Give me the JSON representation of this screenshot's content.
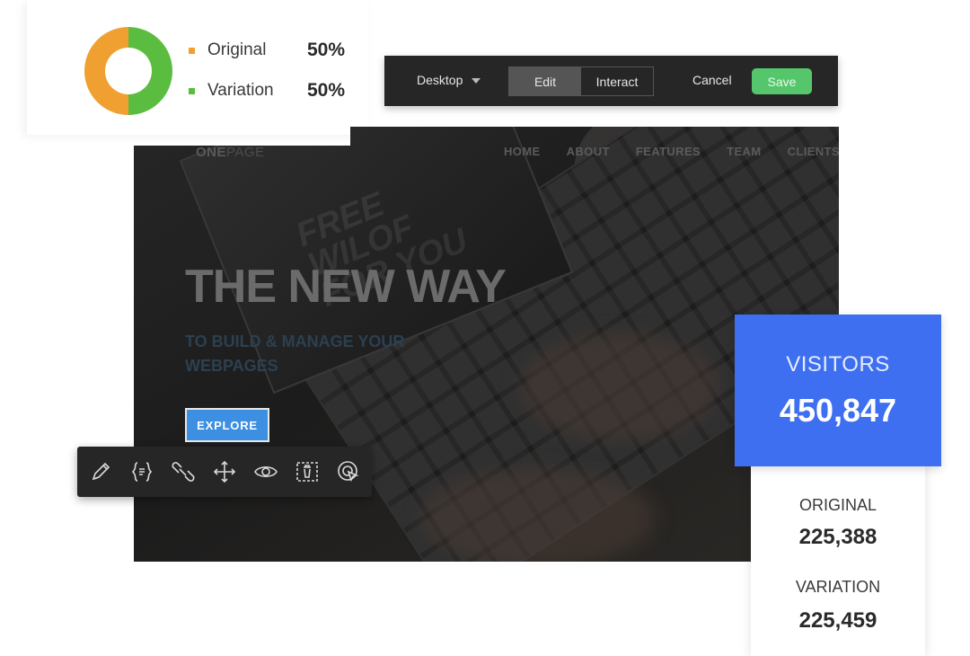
{
  "split_chart": {
    "chart_data": {
      "type": "pie",
      "categories": [
        "Original",
        "Variation"
      ],
      "values": [
        50,
        50
      ],
      "colors": [
        "#f0a030",
        "#5bbd3f"
      ],
      "title": "",
      "xlabel": "",
      "ylabel": ""
    },
    "legend": [
      {
        "label": "Original",
        "percent": "50%",
        "color": "#f0a030"
      },
      {
        "label": "Variation",
        "percent": "50%",
        "color": "#5bbd3f"
      }
    ]
  },
  "editor_toolbar": {
    "device": "Desktop",
    "modes": [
      "Edit",
      "Interact"
    ],
    "active_mode": "Edit",
    "cancel_label": "Cancel",
    "save_label": "Save",
    "save_color": "#55c66b"
  },
  "preview": {
    "brand_bold": "ONE",
    "brand_light": "PAGE",
    "nav": [
      "HOME",
      "ABOUT",
      "FEATURES",
      "TEAM",
      "CLIENTS"
    ],
    "hero_title": "THE NEW WAY",
    "hero_subtitle_line1": "TO BUILD & MANAGE YOUR",
    "hero_subtitle_line2": "WEBPAGES",
    "explore_label": "EXPLORE",
    "screen_text": [
      "FREE",
      "WILOF",
      "FOR YOU"
    ],
    "accent": "#3d8fe2"
  },
  "element_tools": [
    {
      "icon": "pencil-icon"
    },
    {
      "icon": "code-braces-icon"
    },
    {
      "icon": "link-icon"
    },
    {
      "icon": "move-arrows-icon"
    },
    {
      "icon": "eye-icon"
    },
    {
      "icon": "delete-selection-icon"
    },
    {
      "icon": "click-goal-icon"
    }
  ],
  "stats": {
    "visitors_label": "VISITORS",
    "visitors_value": "450,847",
    "visitors_color": "#3e6ff0",
    "original_label": "ORIGINAL",
    "original_value": "225,388",
    "variation_label": "VARIATION",
    "variation_value": "225,459"
  }
}
